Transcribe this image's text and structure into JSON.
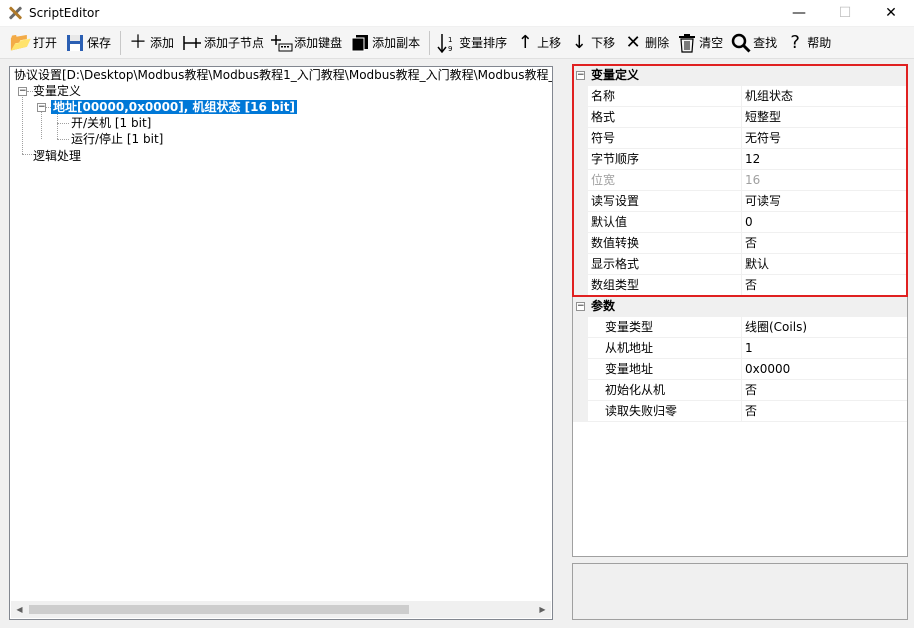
{
  "window": {
    "title": "ScriptEditor"
  },
  "toolbar": {
    "open": "打开",
    "save": "保存",
    "add": "添加",
    "add_child": "添加子节点",
    "add_key": "添加键盘",
    "add_copy": "添加副本",
    "sort_vars": "变量排序",
    "move_up": "上移",
    "move_down": "下移",
    "delete": "删除",
    "clear": "清空",
    "find": "查找",
    "help": "帮助"
  },
  "tree": {
    "root": "协议设置[D:\\Desktop\\Modbus教程\\Modbus教程1_入门教程\\Modbus教程_入门教程\\Modbus教程_入",
    "var_def": "变量定义",
    "address_node": "地址[00000,0x0000], 机组状态 [16 bit]",
    "child1": "开/关机 [1 bit]",
    "child2": "运行/停止 [1 bit]",
    "logic": "逻辑处理"
  },
  "properties": {
    "category1": "变量定义",
    "rows1": [
      {
        "name": "名称",
        "value": "机组状态"
      },
      {
        "name": "格式",
        "value": "短整型"
      },
      {
        "name": "符号",
        "value": "无符号"
      },
      {
        "name": "字节顺序",
        "value": "12"
      },
      {
        "name": "位宽",
        "value": "16"
      },
      {
        "name": "读写设置",
        "value": "可读写"
      },
      {
        "name": "默认值",
        "value": "0"
      },
      {
        "name": "数值转换",
        "value": "否"
      },
      {
        "name": "显示格式",
        "value": "默认"
      },
      {
        "name": "数组类型",
        "value": "否"
      }
    ],
    "category2": "参数",
    "rows2": [
      {
        "name": "变量类型",
        "value": "线圈(Coils)"
      },
      {
        "name": "从机地址",
        "value": "1"
      },
      {
        "name": "变量地址",
        "value": "0x0000"
      },
      {
        "name": "初始化从机",
        "value": "否"
      },
      {
        "name": "读取失败归零",
        "value": "否"
      }
    ]
  },
  "colors": {
    "selection": "#0078d7",
    "highlight": "#e02020"
  }
}
